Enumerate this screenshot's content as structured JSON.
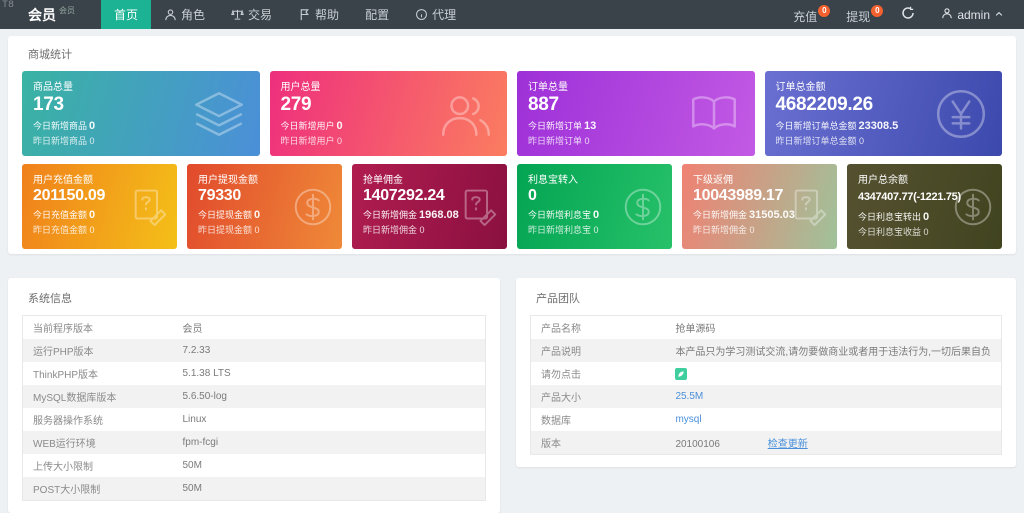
{
  "colors": {
    "navbar_bg": "#3a424a",
    "active_tab_green": "#1cb394",
    "badge_orange": "#f4612e",
    "link_blue": "#4a90d9",
    "page_bg": "#eef1f4"
  },
  "navbar": {
    "watermark": "T8",
    "brand": "会员",
    "brand_sup": "会员",
    "items": [
      {
        "label": "首页",
        "icon": "none",
        "active": true
      },
      {
        "label": "角色",
        "icon": "person-icon",
        "active": false
      },
      {
        "label": "交易",
        "icon": "scales-icon",
        "active": false
      },
      {
        "label": "帮助",
        "icon": "flag-icon",
        "active": false
      },
      {
        "label": "配置",
        "icon": "none",
        "active": false
      },
      {
        "label": "代理",
        "icon": "info-circle-icon",
        "active": false
      }
    ],
    "actions": [
      {
        "label": "充值",
        "badge": "0"
      },
      {
        "label": "提现",
        "badge": "0"
      }
    ],
    "refresh_icon": "refresh-icon",
    "user": {
      "icon": "person-icon",
      "name": "admin",
      "caret": "chevron-up-icon"
    }
  },
  "stats": {
    "title": "商城统计",
    "row1": [
      {
        "title": "商品总量",
        "value": "173",
        "today_label": "今日新增商品",
        "today_value": "0",
        "yst_label": "昨日新增商品",
        "yst_value": "0",
        "icon": "layers-icon",
        "bg": "background:linear-gradient(105deg,#3ab3a3,#4b8fd8)"
      },
      {
        "title": "用户总量",
        "value": "279",
        "today_label": "今日新增用户",
        "today_value": "0",
        "yst_label": "昨日新增用户",
        "yst_value": "0",
        "icon": "users-icon",
        "bg": "background:linear-gradient(105deg,#ee2f7d,#fb7d60)"
      },
      {
        "title": "订单总量",
        "value": "887",
        "today_label": "今日新增订单",
        "today_value": "13",
        "yst_label": "昨日新增订单",
        "yst_value": "0",
        "icon": "book-open-icon",
        "bg": "background:linear-gradient(105deg,#9e30d8,#c35ae4)"
      },
      {
        "title": "订单总金额",
        "value": "4682209.26",
        "today_label": "今日新增订单总金额",
        "today_value": "23308.5",
        "yst_label": "昨日新增订单总金额",
        "yst_value": "0",
        "icon": "yen-circle-icon",
        "bg": "background:linear-gradient(105deg,#6a70d2,#3c49ac)"
      }
    ],
    "row2": [
      {
        "title": "用户充值金额",
        "value": "201150.09",
        "today_label": "今日充值金额",
        "today_value": "0",
        "yst_label": "昨日充值金额",
        "yst_value": "0",
        "icon": "doc-edit-icon",
        "bg": "background:linear-gradient(105deg,#f0801c,#f4c018)"
      },
      {
        "title": "用户提现金额",
        "value": "79330",
        "today_label": "今日提现金额",
        "today_value": "0",
        "yst_label": "昨日提现金额",
        "yst_value": "0",
        "icon": "dollar-circle-icon",
        "bg": "background:linear-gradient(105deg,#e14a2c,#ef8a38)"
      },
      {
        "title": "抢单佣金",
        "value": "1407292.24",
        "today_label": "今日新增佣金",
        "today_value": "1968.08",
        "yst_label": "昨日新增佣金",
        "yst_value": "0",
        "icon": "doc-edit-icon",
        "bg": "background:linear-gradient(105deg,#b01d4f,#8a1040)"
      },
      {
        "title": "利息宝转入",
        "value": "0",
        "today_label": "今日新增利息宝",
        "today_value": "0",
        "yst_label": "昨日新增利息宝",
        "yst_value": "0",
        "icon": "dollar-circle-icon",
        "bg": "background:linear-gradient(105deg,#03a453,#27c169)"
      },
      {
        "title": "下级返佣",
        "value": "10043989.17",
        "today_label": "今日新增佣金",
        "today_value": "31505.03",
        "yst_label": "昨日新增佣金",
        "yst_value": "0",
        "icon": "doc-edit-icon",
        "bg": "background:linear-gradient(105deg,#f08173,#9fc29a)"
      },
      {
        "title": "用户总余额",
        "value": "4347407.77(-1221.75)",
        "today_label": "今日利息宝转出",
        "today_value": "0",
        "yst_label": "今日利息宝收益",
        "yst_value": "0",
        "icon": "dollar-circle-icon",
        "bg": "background:linear-gradient(105deg,#555130,#414420)"
      }
    ]
  },
  "system_info": {
    "title": "系统信息",
    "rows": [
      {
        "label": "当前程序版本",
        "value": "会员"
      },
      {
        "label": "运行PHP版本",
        "value": "7.2.33"
      },
      {
        "label": "ThinkPHP版本",
        "value": "5.1.38 LTS"
      },
      {
        "label": "MySQL数据库版本",
        "value": "5.6.50-log"
      },
      {
        "label": "服务器操作系统",
        "value": "Linux"
      },
      {
        "label": "WEB运行环境",
        "value": "fpm-fcgi"
      },
      {
        "label": "上传大小限制",
        "value": "50M"
      },
      {
        "label": "POST大小限制",
        "value": "50M"
      }
    ]
  },
  "product_team": {
    "title": "产品团队",
    "rows": [
      {
        "label": "产品名称",
        "value": "抢单源码"
      },
      {
        "label": "产品说明",
        "value": "本产品只为学习测试交流,请勿要做商业或者用于违法行为,一切后果自负"
      },
      {
        "label": "请勿点击",
        "value": "",
        "icon": "leaf-icon"
      },
      {
        "label": "产品大小",
        "value": "25.5M",
        "is_link": true
      },
      {
        "label": "数据库",
        "value": "mysql",
        "is_link": true
      },
      {
        "label": "版本",
        "value": "20100106",
        "extra_link": "检查更新"
      }
    ]
  }
}
